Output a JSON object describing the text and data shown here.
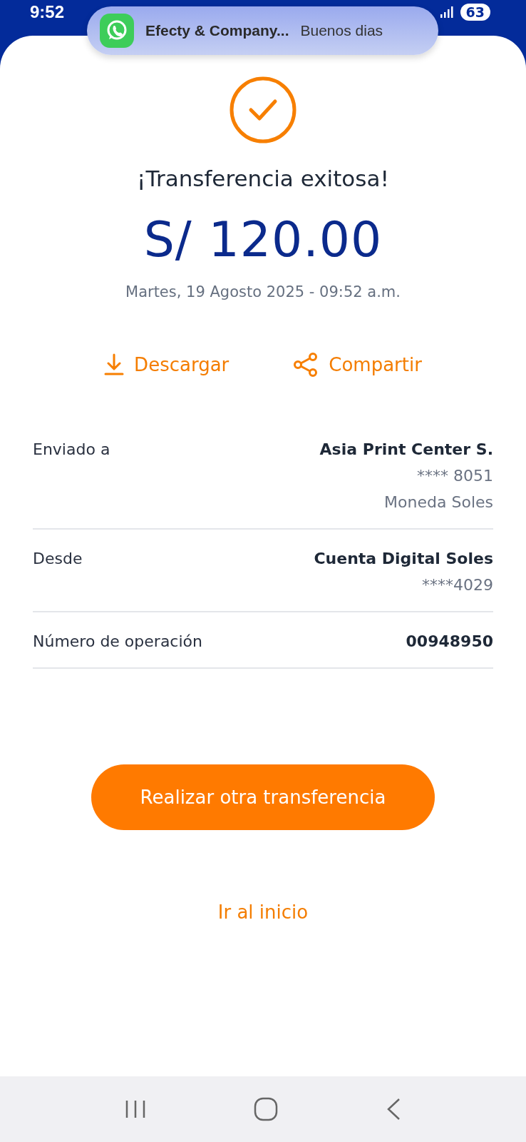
{
  "status_bar": {
    "time": "9:52",
    "battery": "63"
  },
  "notification": {
    "title": "Efecty & Company...",
    "message": "Buenos dias"
  },
  "result": {
    "title": "¡Transferencia exitosa!",
    "amount": "S/ 120.00",
    "date": "Martes, 19 Agosto 2025 - 09:52 a.m."
  },
  "actions": [
    {
      "kind": "download",
      "label": "Descargar"
    },
    {
      "kind": "share",
      "label": "Compartir"
    }
  ],
  "details": [
    {
      "label": "Enviado a",
      "values": [
        {
          "text": "Asia Print Center S.",
          "strong": true
        },
        {
          "text": "**** 8051",
          "strong": false
        },
        {
          "text": "Moneda Soles",
          "strong": false
        }
      ]
    },
    {
      "label": "Desde",
      "values": [
        {
          "text": "Cuenta Digital Soles",
          "strong": true
        },
        {
          "text": "****4029",
          "strong": false
        }
      ]
    },
    {
      "label": "Número de operación",
      "values": [
        {
          "text": "00948950",
          "strong": true
        }
      ]
    }
  ],
  "primary_button": "Realizar otra transferencia",
  "home_link": "Ir al inicio"
}
